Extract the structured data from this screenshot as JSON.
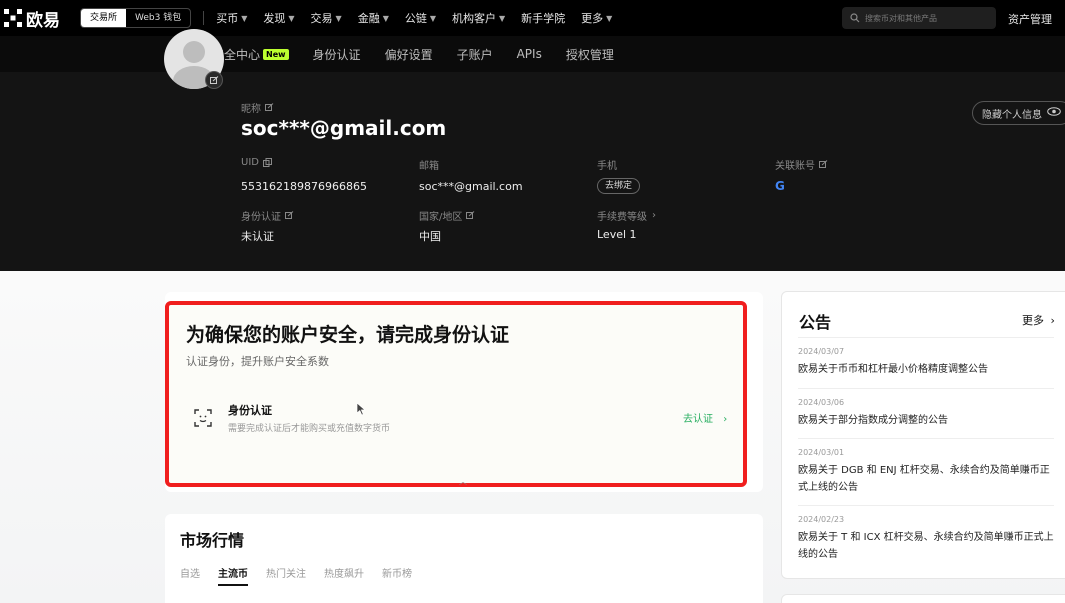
{
  "topnav": {
    "logo_text": "欧易",
    "switch": [
      "交易所",
      "Web3 钱包"
    ],
    "items": [
      "买币",
      "发现",
      "交易",
      "金融",
      "公链",
      "机构客户",
      "新手学院",
      "更多"
    ],
    "search_placeholder": "搜索币对和其他产品",
    "asset_label": "资产管理"
  },
  "subnav": {
    "items": [
      "总览",
      "安全中心",
      "身份认证",
      "偏好设置",
      "子账户",
      "APIs",
      "授权管理"
    ],
    "new_badge": "New"
  },
  "profile": {
    "nickname_label": "昵称",
    "email_display": "soc***@gmail.com",
    "hide_info_label": "隐藏个人信息",
    "uid_label": "UID",
    "uid_value": "553162189876966865",
    "mail_label": "邮箱",
    "mail_value": "soc***@gmail.com",
    "phone_label": "手机",
    "phone_bind_button": "去绑定",
    "linked_label": "关联账号",
    "linked_icon": "G",
    "kyc_label": "身份认证",
    "kyc_value": "未认证",
    "region_label": "国家/地区",
    "region_value": "中国",
    "fee_label": "手续费等级",
    "fee_value": "Level 1"
  },
  "verify": {
    "title": "为确保您的账户安全，请完成身份认证",
    "subtitle": "认证身份，提升账户安全系数",
    "row_title": "身份认证",
    "row_desc": "需要完成认证后才能购买或充值数字货币",
    "action": "去认证"
  },
  "market": {
    "title": "市场行情",
    "tabs": [
      "自选",
      "主流币",
      "热门关注",
      "热度飙升",
      "新币榜"
    ]
  },
  "notices": {
    "title": "公告",
    "more": "更多",
    "items": [
      {
        "date": "2024/03/07",
        "text": "欧易关于币币和杠杆最小价格精度调整公告"
      },
      {
        "date": "2024/03/06",
        "text": "欧易关于部分指数成分调整的公告"
      },
      {
        "date": "2024/03/01",
        "text": "欧易关于 DGB 和 ENJ 杠杆交易、永续合约及简单赚币正式上线的公告"
      },
      {
        "date": "2024/02/23",
        "text": "欧易关于 T 和 ICX 杠杆交易、永续合约及简单赚币正式上线的公告"
      }
    ]
  },
  "colors": {
    "accent_green": "#27ae60",
    "new_badge": "#bcff2f",
    "highlight_red": "#f01e1e"
  }
}
